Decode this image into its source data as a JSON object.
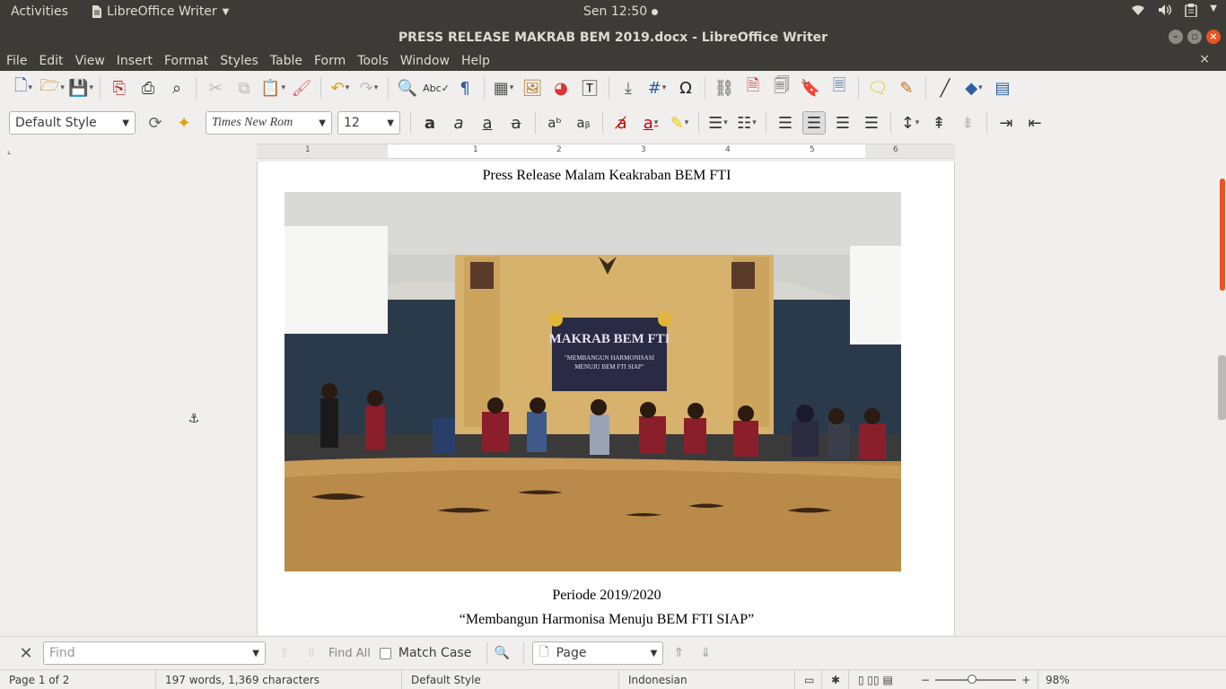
{
  "system_bar": {
    "activities": "Activities",
    "app_name": "LibreOffice Writer",
    "clock": "Sen 12:50",
    "tray_icons": [
      "wifi-icon",
      "volume-icon",
      "clipboard-icon",
      "chevron-down-icon"
    ]
  },
  "window": {
    "title": "PRESS RELEASE MAKRAB BEM 2019.docx - LibreOffice Writer",
    "controls": [
      "minimize-icon",
      "maximize-icon",
      "close-icon"
    ]
  },
  "menu": {
    "items": [
      "File",
      "Edit",
      "View",
      "Insert",
      "Format",
      "Styles",
      "Table",
      "Form",
      "Tools",
      "Window",
      "Help"
    ],
    "doc_close": "×"
  },
  "toolbar": {
    "paragraph_style": "Default Style",
    "font_name": "Times New Rom",
    "font_size": "12"
  },
  "ruler": {
    "numbers": [
      "1",
      "1",
      "2",
      "3",
      "4",
      "5",
      "6"
    ]
  },
  "document": {
    "header_line": "Press Release Malam Keakraban BEM FTI",
    "photo_banner_title": "MAKRAB BEM FTI",
    "photo_banner_sub1": "\"MEMBANGUN HARMONISASI",
    "photo_banner_sub2": "MENUJU BEM FTI SIAP\"",
    "period": "Periode 2019/2020",
    "slogan": "“Membangun Harmonisa Menuju BEM FTI SIAP”"
  },
  "findbar": {
    "find_placeholder": "Find",
    "find_all": "Find All",
    "match_case": "Match Case",
    "search_scope": "Page"
  },
  "status": {
    "page": "Page 1 of 2",
    "counts": "197 words, 1,369 characters",
    "style": "Default Style",
    "language": "Indonesian",
    "zoom": "98%"
  },
  "colors": {
    "accent": "#e95420",
    "system_bar": "#3c3b37"
  }
}
